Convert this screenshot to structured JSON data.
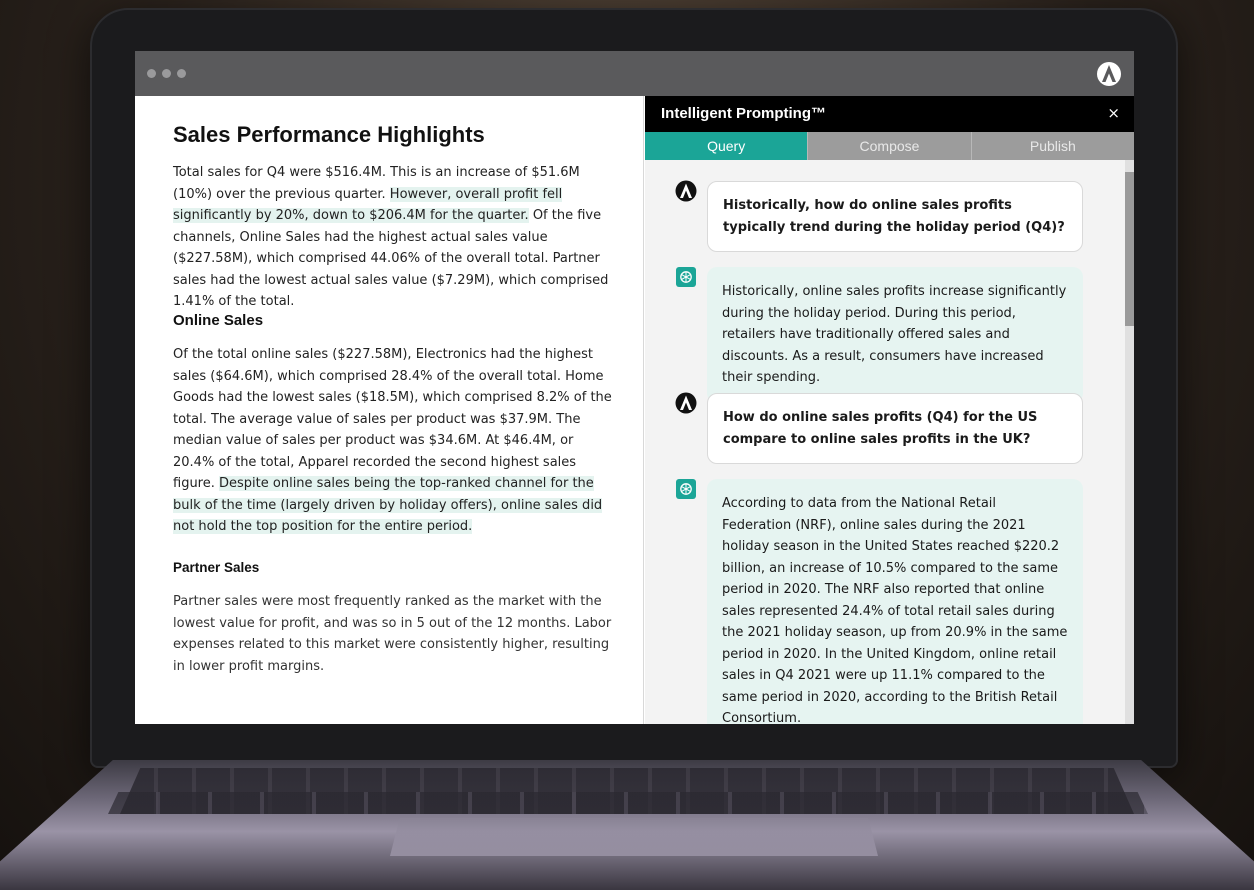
{
  "window": {
    "title": "",
    "colors": {
      "accent": "#1ba597",
      "highlight": "#e4f3ef",
      "titlebar": "#5a5a5c"
    }
  },
  "doc": {
    "title": "Sales Performance Highlights",
    "intro": {
      "p1": "Total sales for Q4 were $516.4M. This is an increase of $51.6M (10%) over the previous quarter. ",
      "p1_hl": "However, overall profit fell significantly by 20%, down to $206.4M for the quarter.",
      "p1_rest": " Of the five channels, Online Sales had the highest actual sales value ($227.58M), which comprised 44.06% of the overall total. Partner sales had the lowest actual sales value ($7.29M), which comprised 1.41% of the total."
    },
    "online": {
      "heading": "Online Sales",
      "body": "Of the total online sales ($227.58M), Electronics had the highest sales ($64.6M), which comprised 28.4% of the overall total. Home Goods had the lowest sales ($18.5M), which comprised 8.2% of the total. The average value of sales per product was $37.9M. The median value of sales per product was $34.6M. At $46.4M, or 20.4% of the total, Apparel recorded the second highest sales figure. ",
      "body_hl": "Despite online sales being the top-ranked channel for the bulk of the time (largely driven by holiday offers), online sales did not hold the top position for the entire period."
    },
    "partner": {
      "heading": "Partner Sales",
      "body": "Partner sales were most frequently ranked as the market with the lowest value for profit, and was so in 5 out of the 12 months. Labor expenses related to this market were consistently higher, resulting in lower profit margins."
    }
  },
  "panel": {
    "title": "Intelligent Prompting™",
    "close": "×",
    "tabs": [
      {
        "label": "Query",
        "active": true
      },
      {
        "label": "Compose",
        "active": false
      },
      {
        "label": "Publish",
        "active": false
      }
    ],
    "messages": [
      {
        "role": "user",
        "text": "Historically, how do online sales profits typically trend during the holiday period (Q4)?"
      },
      {
        "role": "assistant",
        "text": "Historically, online sales profits increase significantly during the holiday period. During this period, retailers have traditionally offered sales and discounts. As a result, consumers have increased their spending."
      },
      {
        "role": "user",
        "text": "How do online sales profits (Q4) for the US compare to online sales profits in the UK?"
      },
      {
        "role": "assistant",
        "text": "According to data from the National Retail Federation (NRF), online sales during the 2021 holiday season in the United States reached $220.2 billion, an increase of 10.5% compared to the same period in 2020. The NRF also reported that online sales represented 24.4% of total retail sales during the 2021 holiday season, up from 20.9% in the same period in 2020. In the United Kingdom, online retail sales in Q4 2021 were up 11.1% compared to the same period in 2020, according to the British Retail Consortium."
      }
    ]
  }
}
